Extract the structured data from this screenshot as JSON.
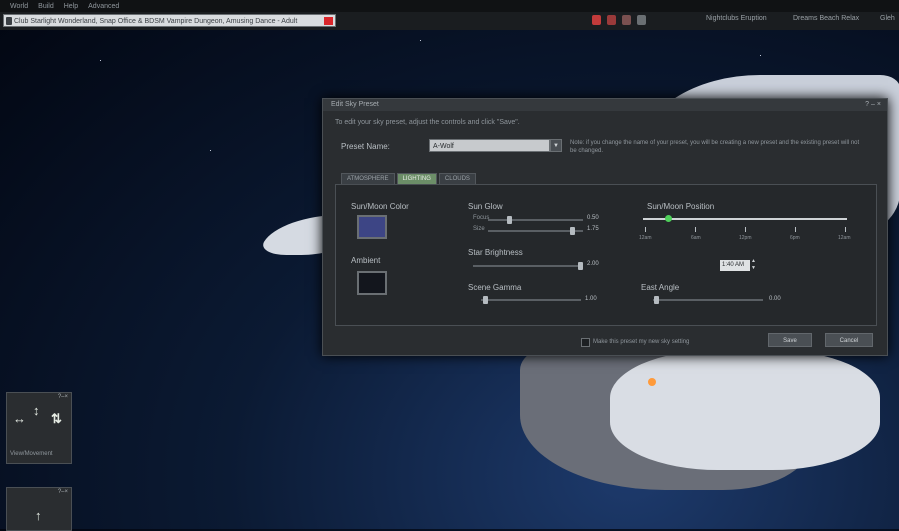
{
  "menu": [
    "World",
    "Build",
    "Help",
    "Advanced"
  ],
  "browser": {
    "url": "Club Starlight Wonderland, Snap Office & BDSM Vampire Dungeon, Amusing Dance - Adult",
    "favorites": [
      "Nightclubs Eruption",
      "Dreams Beach Relax",
      "Gleh"
    ]
  },
  "dialog": {
    "title": "Edit Sky Preset",
    "instructions": "To edit your sky preset, adjust the controls and click \"Save\".",
    "preset_label": "Preset Name:",
    "preset_value": "A-Wolf",
    "note": "Note: if you change the name of your preset, you will be creating a new preset and the existing preset will not be changed.",
    "tabs": [
      "ATMOSPHERE",
      "LIGHTING",
      "CLOUDS"
    ],
    "active_tab": "LIGHTING",
    "sun_moon_color_label": "Sun/Moon Color",
    "sun_moon_color": "#3d4585",
    "ambient_label": "Ambient",
    "ambient_color": "#13161d",
    "sun_glow_label": "Sun Glow",
    "focus_label": "Focus",
    "focus_value": "0.50",
    "focus_level": 0.22,
    "size_label": "Size",
    "size_value": "1.75",
    "size_level": 0.88,
    "star_brightness_label": "Star Brightness",
    "star_brightness_value": "2.00",
    "star_brightness_level": 1.0,
    "scene_gamma_label": "Scene Gamma",
    "scene_gamma_value": "1.00",
    "scene_gamma_level": 0.04,
    "sun_moon_position_label": "Sun/Moon Position",
    "timeline_level": 0.12,
    "time_labels": [
      "12am",
      "6am",
      "12pm",
      "6pm",
      "12am"
    ],
    "time_value": "1:40 AM",
    "east_angle_label": "East Angle",
    "east_angle_value": "0.00",
    "east_angle_level": 0.03,
    "make_default_label": "Make this preset my new sky setting",
    "save_label": "Save",
    "cancel_label": "Cancel"
  },
  "panels": {
    "camera_caption": "View/Movement"
  },
  "colors": {
    "accent_tab": "#6c8e68",
    "timeline_thumb": "#4ed05a"
  }
}
